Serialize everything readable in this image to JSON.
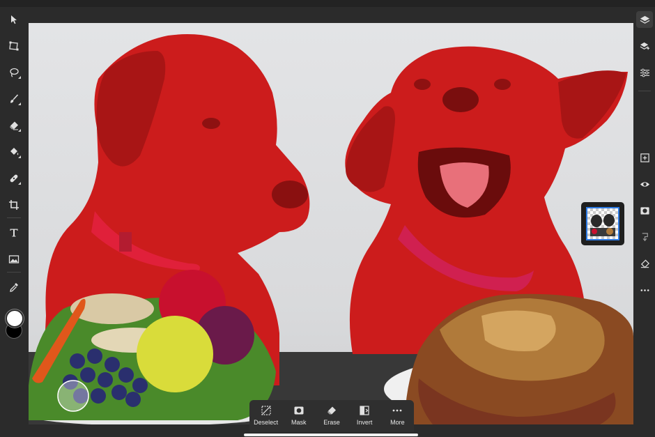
{
  "app": {
    "accent_color": "#2d7be5",
    "selection_overlay_color": "#d01c1c"
  },
  "left_toolbar": {
    "tools": [
      {
        "name": "select-tool",
        "icon": "arrow-cursor-icon"
      },
      {
        "name": "transform-tool",
        "icon": "transform-icon"
      },
      {
        "name": "lasso-tool",
        "icon": "lasso-icon"
      },
      {
        "name": "brush-tool",
        "icon": "brush-icon"
      },
      {
        "name": "eraser-tool",
        "icon": "eraser-icon"
      },
      {
        "name": "fill-tool",
        "icon": "paint-bucket-icon"
      },
      {
        "name": "healing-tool",
        "icon": "bandage-icon"
      },
      {
        "name": "crop-tool",
        "icon": "crop-icon"
      },
      {
        "name": "type-tool",
        "icon": "type-icon"
      },
      {
        "name": "place-image-tool",
        "icon": "image-icon"
      },
      {
        "name": "eyedropper-tool",
        "icon": "eyedropper-icon"
      }
    ],
    "foreground_color": "#ffffff",
    "background_color": "#000000"
  },
  "right_toolbar": {
    "tools": [
      {
        "name": "layers-button",
        "icon": "layers-icon"
      },
      {
        "name": "layer-properties-button",
        "icon": "layer-stack-icon"
      },
      {
        "name": "adjustments-button",
        "icon": "sliders-icon"
      },
      {
        "name": "add-layer-button",
        "icon": "plus-square-icon"
      },
      {
        "name": "visibility-button",
        "icon": "eye-icon"
      },
      {
        "name": "mask-button",
        "icon": "mask-icon"
      },
      {
        "name": "merge-button",
        "icon": "merge-icon"
      },
      {
        "name": "clear-button",
        "icon": "eraser-icon"
      },
      {
        "name": "more-options-button",
        "icon": "ellipsis-icon"
      }
    ]
  },
  "context_bar": {
    "actions": [
      {
        "label": "Deselect",
        "icon": "deselect-icon"
      },
      {
        "label": "Mask",
        "icon": "mask-icon"
      },
      {
        "label": "Erase",
        "icon": "eraser-icon"
      },
      {
        "label": "Invert",
        "icon": "invert-icon"
      },
      {
        "label": "More",
        "icon": "ellipsis-icon"
      }
    ]
  }
}
